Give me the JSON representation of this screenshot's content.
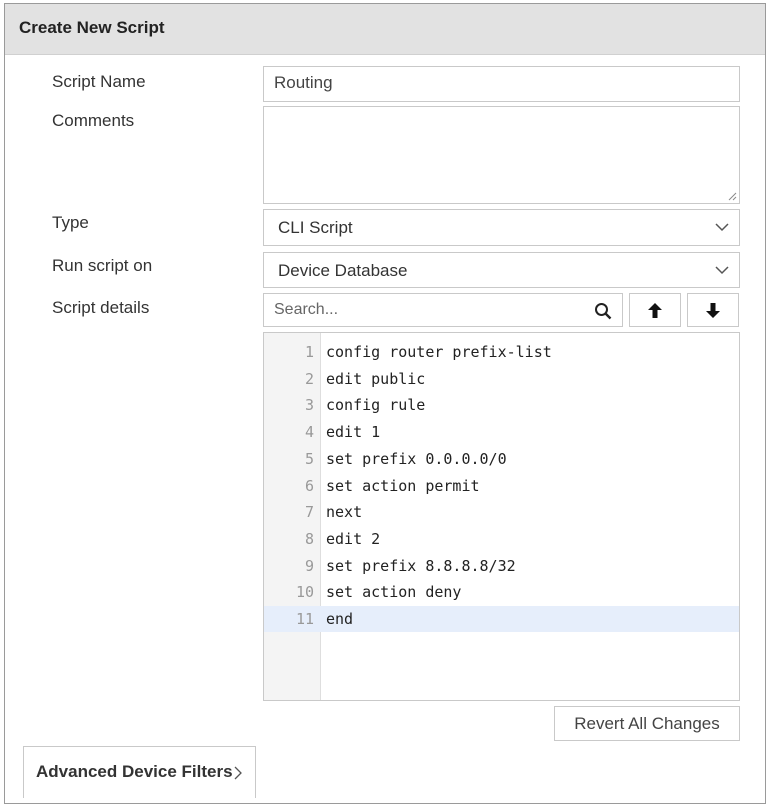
{
  "dialog": {
    "title": "Create New Script"
  },
  "form": {
    "script_name": {
      "label": "Script Name",
      "value": "Routing"
    },
    "comments": {
      "label": "Comments",
      "value": ""
    },
    "type": {
      "label": "Type",
      "value": "CLI Script"
    },
    "run_on": {
      "label": "Run script on",
      "value": "Device Database"
    },
    "details": {
      "label": "Script details"
    }
  },
  "search": {
    "placeholder": "Search...",
    "icon": "search-icon"
  },
  "nav": {
    "up_icon": "arrow-up-icon",
    "down_icon": "arrow-down-icon"
  },
  "editor": {
    "active_line": 11,
    "lines": [
      {
        "num": "1",
        "text": "config router prefix-list"
      },
      {
        "num": "2",
        "text": "edit public"
      },
      {
        "num": "3",
        "text": "config rule"
      },
      {
        "num": "4",
        "text": "edit 1"
      },
      {
        "num": "5",
        "text": "set prefix 0.0.0.0/0"
      },
      {
        "num": "6",
        "text": "set action permit"
      },
      {
        "num": "7",
        "text": "next"
      },
      {
        "num": "8",
        "text": "edit 2"
      },
      {
        "num": "9",
        "text": "set prefix 8.8.8.8/32"
      },
      {
        "num": "10",
        "text": "set action deny"
      },
      {
        "num": "11",
        "text": "end"
      }
    ]
  },
  "buttons": {
    "revert": "Revert All Changes"
  },
  "advanced": {
    "label": "Advanced Device Filters",
    "icon": "chevron-right-icon"
  },
  "colors": {
    "header_bg": "#e2e2e2",
    "active_line_bg": "#e6eefb",
    "border": "#c9c9c9"
  }
}
